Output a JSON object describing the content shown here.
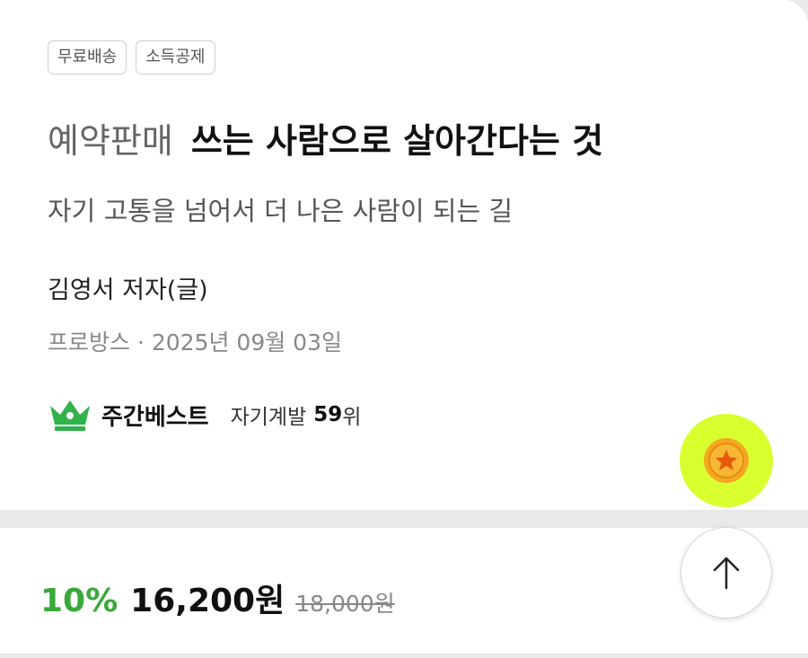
{
  "tags": [
    "무료배송",
    "소득공제"
  ],
  "book": {
    "preorder_label": "예약판매",
    "title": "쓰는 사람으로 살아간다는 것",
    "subtitle": "자기 고통을 넘어서 더 나은 사람이 되는 길",
    "author": "김영서 저자(글)",
    "pubinfo": "프로방스 · 2025년 09월 03일"
  },
  "ranking": {
    "label": "주간베스트",
    "category": "자기계발",
    "rank": "59",
    "unit": "위",
    "icon": "crown-icon"
  },
  "price": {
    "discount": "10%",
    "sale_price": "16,200원",
    "original_price": "18,000원"
  },
  "floating": {
    "coin_icon": "star-coin-icon",
    "top_icon": "arrow-up-icon"
  },
  "colors": {
    "discount_green": "#3aa83a",
    "crown_green": "#2fb34a",
    "coin_bg": "#d9ff2e",
    "coin_gold": "#f5a623"
  }
}
